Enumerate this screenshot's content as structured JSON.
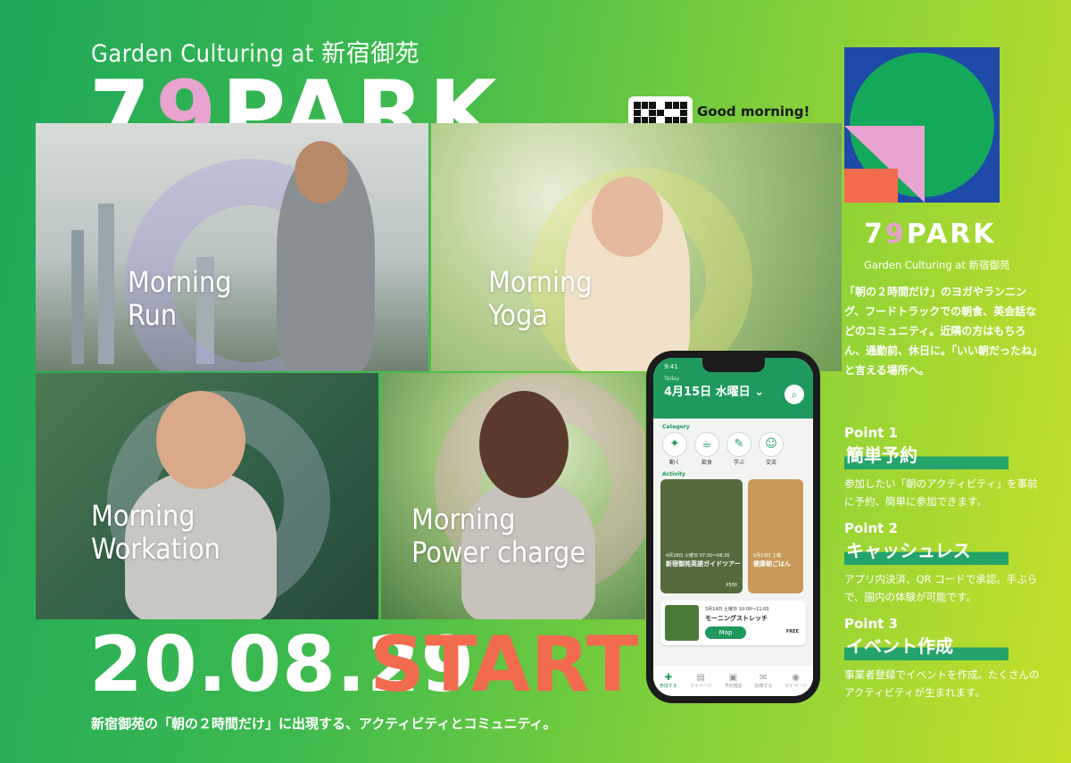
{
  "header": {
    "subtitle": "Garden Culturing at 新宿御苑",
    "logo_7": "7",
    "logo_9": "9",
    "logo_park": "PARK",
    "greeting": "Good morning!"
  },
  "tiles": [
    {
      "label_1": "Morning",
      "label_2": "Run"
    },
    {
      "label_1": "Morning",
      "label_2": "Yoga"
    },
    {
      "label_1": "Morning",
      "label_2": "Workation"
    },
    {
      "label_1": "Morning",
      "label_2": "Power charge"
    }
  ],
  "launch": {
    "date": "20.08.29",
    "word": "START",
    "tagline": "新宿御苑の「朝の２時間だけ」に出現する、アクティビティとコミュニティ。"
  },
  "brand": {
    "name_7": "7",
    "name_9": "9",
    "name_park": "PARK",
    "sub": "Garden Culturing at 新宿御苑",
    "description": "「朝の２時間だけ」のヨガやランニング、フードトラックでの朝食、英会話などのコミュニティ。近隣の方はもちろん、通勤前、休日に。「いい朝だったね」と言える場所へ。"
  },
  "points": [
    {
      "title": "Point 1",
      "head": "簡単予約",
      "text": "参加したい「朝のアクティビティ」を事前に予約、簡単に参加できます。"
    },
    {
      "title": "Point 2",
      "head": "キャッシュレス",
      "text": "アプリ内決済、QR コードで承認。手ぶらで、園内の体験が可能です。"
    },
    {
      "title": "Point 3",
      "head": "イベント作成",
      "text": "事業者登録でイベントを作成。たくさんのアクティビティが生まれます。"
    }
  ],
  "phone": {
    "time": "9:41",
    "today": "Today",
    "date": "4月15日 水曜日 ⌄",
    "category_label": "Category",
    "categories": [
      "動く",
      "飲食",
      "学ぶ",
      "交流"
    ],
    "activity_label": "Activity",
    "card1": {
      "date": "4月28日 火曜日 07:30〜08:30",
      "title": "新宿御苑英語ガイドツアー",
      "price": "¥500"
    },
    "card2": {
      "date": "5月14日 土曜",
      "title": "健康朝ごはん"
    },
    "event": {
      "date": "3月14日 土曜日 10:00〜11:00",
      "title": "モーニングストレッチ",
      "map": "Map",
      "free": "FREE"
    },
    "tabs": [
      "参加する",
      "マイページ",
      "予約確認",
      "投稿する",
      "マイページ"
    ]
  }
}
